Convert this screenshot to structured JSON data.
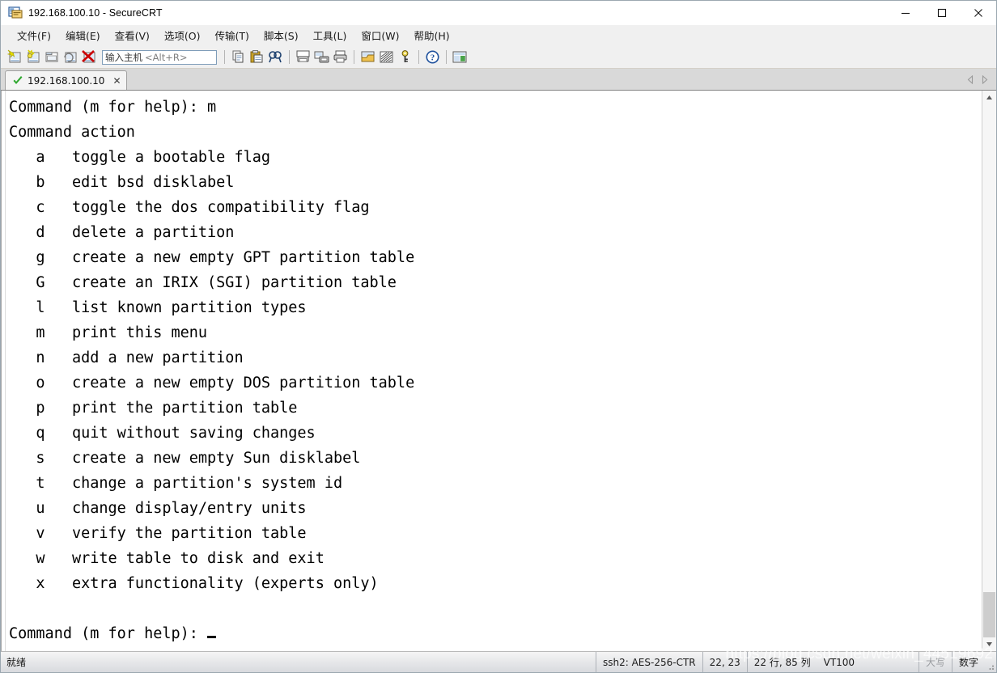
{
  "window": {
    "title": "192.168.100.10 - SecureCRT",
    "app_icon": "securecrt-icon",
    "minimize_label": "—",
    "maximize_label": "□",
    "close_label": "✕"
  },
  "menubar": {
    "items": [
      {
        "label": "文件(F)",
        "name": "menu-file"
      },
      {
        "label": "编辑(E)",
        "name": "menu-edit"
      },
      {
        "label": "查看(V)",
        "name": "menu-view"
      },
      {
        "label": "选项(O)",
        "name": "menu-options"
      },
      {
        "label": "传输(T)",
        "name": "menu-transfer"
      },
      {
        "label": "脚本(S)",
        "name": "menu-script"
      },
      {
        "label": "工具(L)",
        "name": "menu-tools"
      },
      {
        "label": "窗口(W)",
        "name": "menu-window"
      },
      {
        "label": "帮助(H)",
        "name": "menu-help"
      }
    ]
  },
  "toolbar": {
    "host_field": {
      "placeholder": "输入主机",
      "hint": "<Alt+R>"
    },
    "icons_left": [
      "new-session-icon",
      "quick-connect-icon",
      "connect-in-tab-icon",
      "reconnect-icon",
      "disconnect-icon"
    ],
    "icons_right": [
      "copy-icon",
      "paste-icon",
      "find-icon",
      "print-screen-icon",
      "log-session-icon",
      "print-icon",
      "session-options-icon",
      "transfer-icon",
      "key-icon",
      "help-icon",
      "arrange-icon"
    ]
  },
  "tabs": {
    "items": [
      {
        "label": "192.168.100.10",
        "status_icon": "connected-check-icon",
        "close_label": "✕",
        "active": true
      }
    ],
    "nav_prev": "◁",
    "nav_next": "▷"
  },
  "terminal": {
    "lines": [
      "Command (m for help): m",
      "Command action",
      "   a   toggle a bootable flag",
      "   b   edit bsd disklabel",
      "   c   toggle the dos compatibility flag",
      "   d   delete a partition",
      "   g   create a new empty GPT partition table",
      "   G   create an IRIX (SGI) partition table",
      "   l   list known partition types",
      "   m   print this menu",
      "   n   add a new partition",
      "   o   create a new empty DOS partition table",
      "   p   print the partition table",
      "   q   quit without saving changes",
      "   s   create a new empty Sun disklabel",
      "   t   change a partition's system id",
      "   u   change display/entry units",
      "   v   verify the partition table",
      "   w   write table to disk and exit",
      "   x   extra functionality (experts only)",
      "",
      "Command (m for help): "
    ],
    "cursor": "_",
    "foreground": "#000000",
    "background": "#ffffff"
  },
  "statusbar": {
    "ready": "就绪",
    "cipher": "ssh2: AES-256-CTR",
    "position": "22, 23",
    "size": "22 行, 85 列",
    "emulation": "VT100",
    "caps": "大写",
    "num": "数字"
  },
  "watermark": {
    "text": "https://blog.csdn.net/weixin_44519692"
  }
}
